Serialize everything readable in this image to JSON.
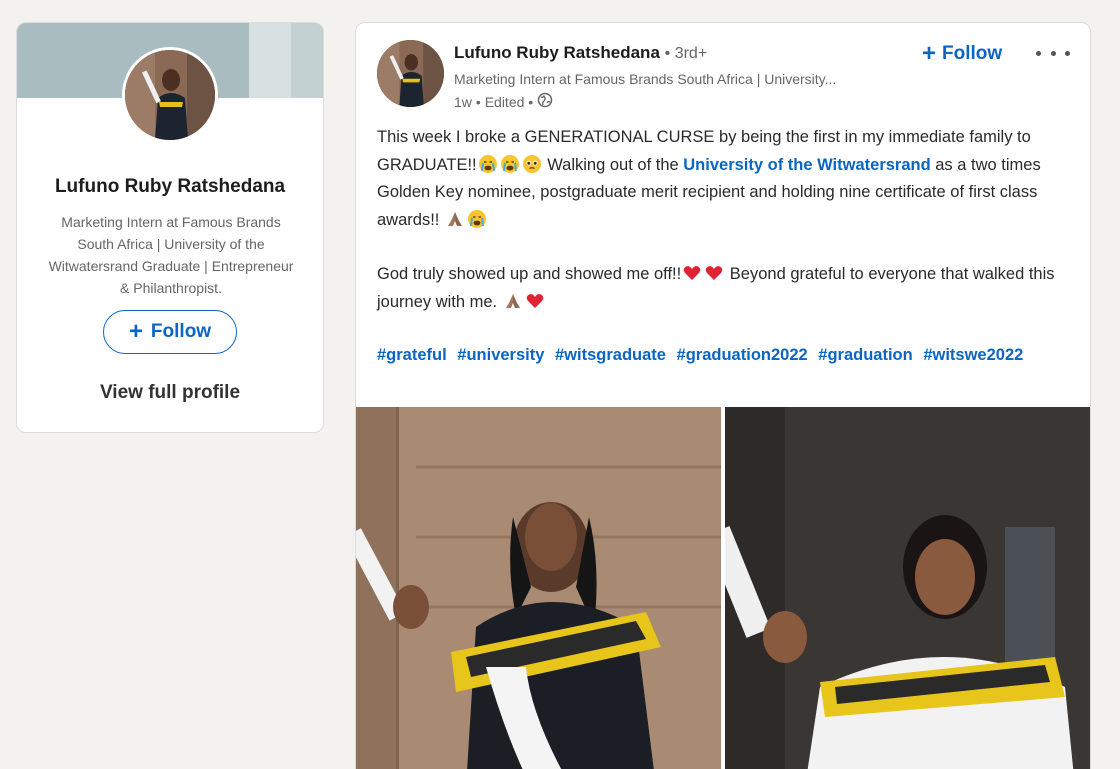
{
  "profile": {
    "name": "Lufuno Ruby Ratshedana",
    "headline": "Marketing Intern at Famous Brands South Africa | University of the Witwatersrand Graduate | Entrepreneur & Philanthropist.",
    "follow_label": "Follow",
    "view_profile_label": "View full profile"
  },
  "post": {
    "author_name": "Lufuno Ruby Ratshedana",
    "author_degree": "• 3rd+",
    "author_headline": "Marketing Intern at Famous Brands South Africa | University...",
    "time": "1w",
    "edited": "• Edited •",
    "follow_label": "Follow",
    "text1_a": "This week I broke a GENERATIONAL CURSE by being the first in my immediate family to GRADUATE!!",
    "text1_b": " Walking out of the ",
    "mention": "University of the Witwatersrand",
    "text1_c": " as a two times Golden Key nominee, postgraduate merit recipient and holding nine certificate of first class awards!! ",
    "text2_a": "God truly showed up and showed me off!!",
    "text2_b": " Beyond grateful to everyone that walked this journey with me. ",
    "hashtags": [
      "#grateful",
      "#university",
      "#witsgraduate",
      "#graduation2022",
      "#graduation",
      "#witswe2022"
    ]
  },
  "colors": {
    "accent": "#0a66c2",
    "background": "#f3f2ef",
    "cover": "#a9bcbf"
  }
}
